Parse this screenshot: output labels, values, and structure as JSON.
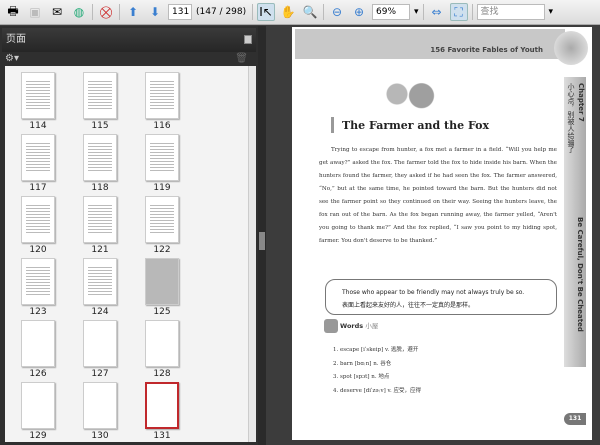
{
  "toolbar": {
    "page_input": "131",
    "page_count": "(147 / 298)",
    "zoom": "69%",
    "search_placeholder": "查找"
  },
  "sidebar": {
    "title": "页面",
    "thumbnails": [
      "114",
      "115",
      "116",
      "117",
      "118",
      "119",
      "120",
      "121",
      "122",
      "123",
      "124",
      "125",
      "126",
      "127",
      "128",
      "129",
      "130",
      "131"
    ],
    "selected": "131"
  },
  "page": {
    "header": "156 Favorite Fables of Youth",
    "chapter": "Chapter 7",
    "chapter_cn": "小心点，别被人给骗了",
    "side_title": "Be Careful, Don't Be Cheated",
    "title": "The Farmer and the Fox",
    "story": "Trying to escape from hunter, a fox met a farmer in a field. “Will you help me get away?” asked the fox. The farmer told the fox to hide inside his barn. When the hunters found the farmer, they asked if he had seen the fox. The farmer answered, “No,” but at the same time, he pointed toward the barn. But the hunters did not see the farmer point so they continued on their way. Seeing the hunters leave, the fox ran out of the barn. As the fox began running away, the farmer yelled, “Aren't you going to thank me?” And the fox replied, “I saw you point to my hiding spot, farmer. You don't deserve to be thanked.”",
    "moral_en": "Those who appear to be friendly may not always truly be so.",
    "moral_cn": "表面上看起来友好的人，往往不一定真的是那样。",
    "words_label": "Words",
    "words_cn": "小屋",
    "words": [
      "1. escape [iˈskeip] v. 逃脱，避开",
      "2. barn [bɑːn] n. 谷仓",
      "3. spot [spɔt] n. 地点",
      "4. deserve [diˈzəːv] v. 应受，应得"
    ],
    "number": "131"
  }
}
